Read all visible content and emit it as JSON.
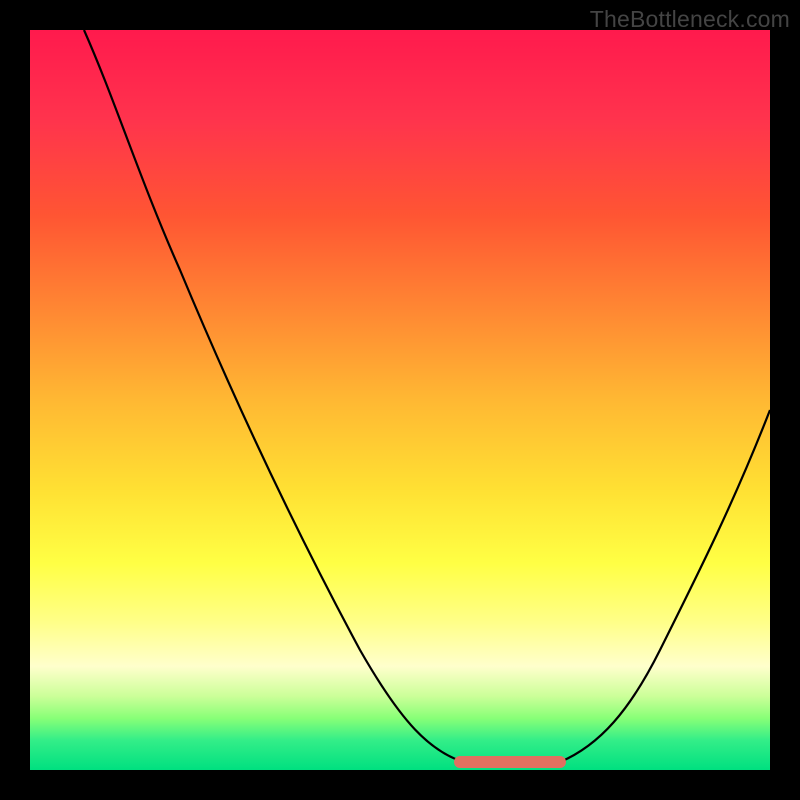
{
  "watermark": "TheBottleneck.com",
  "colors": {
    "frame": "#000000",
    "curve": "#000000",
    "accent": "#e17060",
    "gradient_top": "#ff1a4d",
    "gradient_bottom": "#00e080"
  },
  "chart_data": {
    "type": "line",
    "title": "",
    "xlabel": "",
    "ylabel": "",
    "xlim": [
      0,
      1
    ],
    "ylim": [
      0,
      1
    ],
    "x": [
      0.0,
      0.05,
      0.1,
      0.15,
      0.2,
      0.25,
      0.3,
      0.35,
      0.4,
      0.45,
      0.5,
      0.55,
      0.58,
      0.62,
      0.68,
      0.72,
      0.78,
      0.82,
      0.88,
      0.94,
      1.0
    ],
    "values": [
      1.0,
      0.95,
      0.87,
      0.79,
      0.7,
      0.61,
      0.52,
      0.43,
      0.34,
      0.25,
      0.16,
      0.08,
      0.02,
      0.0,
      0.0,
      0.02,
      0.08,
      0.15,
      0.25,
      0.36,
      0.49
    ],
    "annotations": [
      {
        "type": "highlight-range",
        "x_start": 0.58,
        "x_end": 0.72,
        "note": "accent segment at minimum"
      }
    ]
  }
}
